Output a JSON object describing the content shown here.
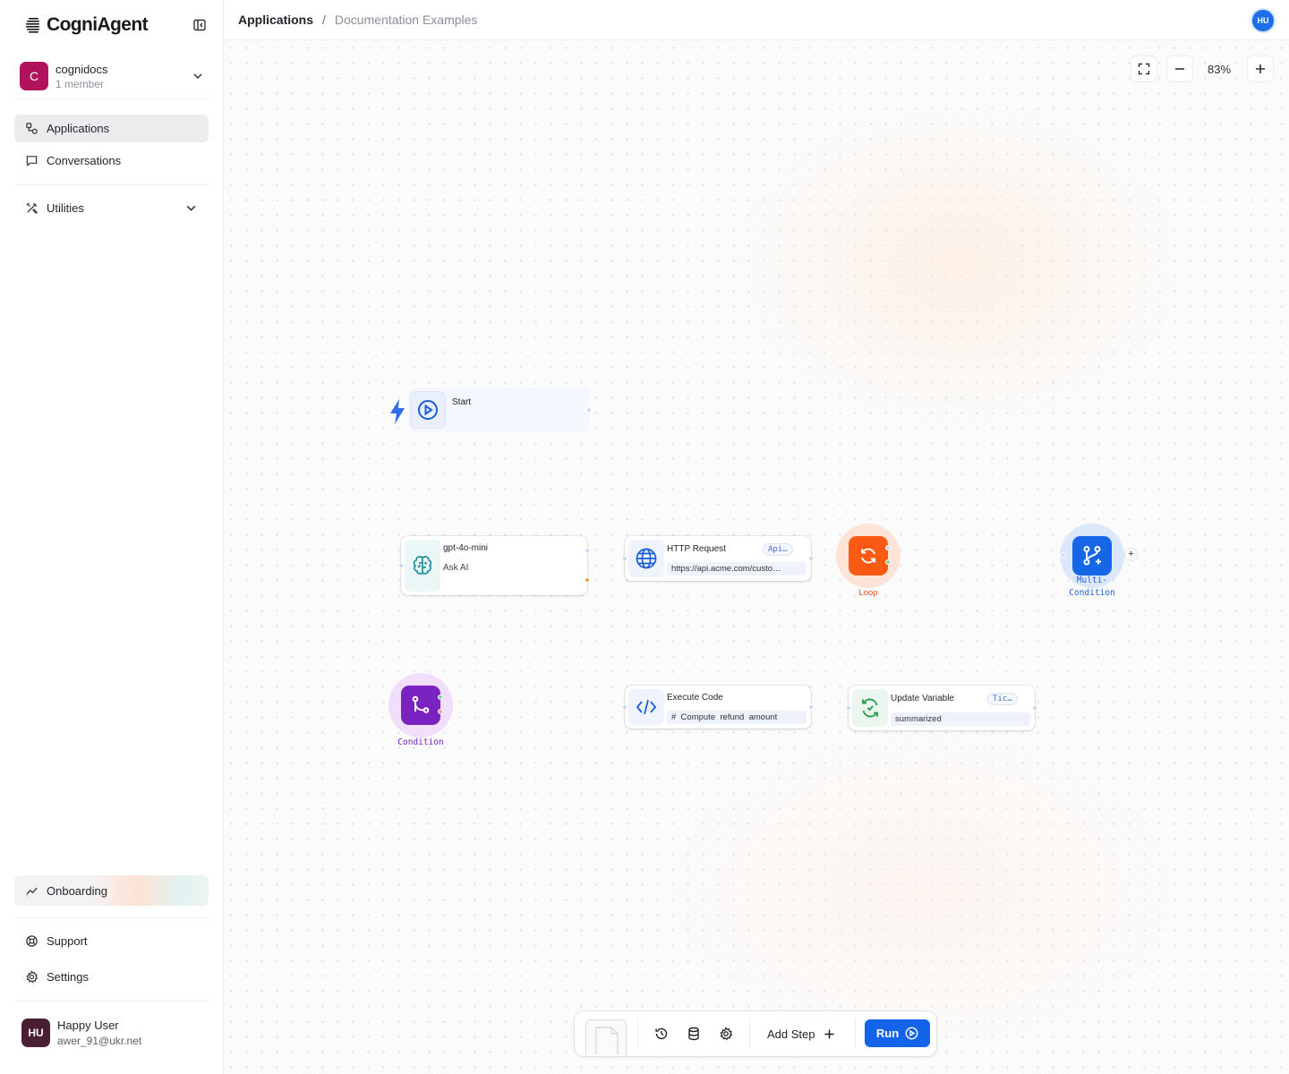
{
  "app": {
    "logo_text": "CogniAgent",
    "org_initial": "C",
    "org_name": "cognidocs",
    "org_members": "1 member"
  },
  "sidebar": {
    "nav": [
      {
        "label": "Applications",
        "icon": "applications-icon",
        "active": true
      },
      {
        "label": "Conversations",
        "icon": "chat-bubble-icon",
        "active": false
      }
    ],
    "utilities_label": "Utilities",
    "onboarding_label": "Onboarding",
    "bottom": [
      {
        "label": "Support",
        "icon": "lifebuoy-icon"
      },
      {
        "label": "Settings",
        "icon": "gear-icon"
      }
    ],
    "user": {
      "initials": "HU",
      "name": "Happy User",
      "email": "awer_91@ukr.net"
    }
  },
  "header": {
    "breadcrumb_root": "Applications",
    "breadcrumb_sep": "/",
    "breadcrumb_leaf": "Documentation Examples",
    "avatar_initials": "HU"
  },
  "canvas": {
    "zoom_level": "83%",
    "nodes": {
      "start": {
        "title": "Start"
      },
      "llm": {
        "title": "gpt-4o-mini",
        "subtitle": "Ask AI"
      },
      "http": {
        "title": "HTTP Request",
        "badge": "Api…",
        "field": "https://api.acme.com/custo…"
      },
      "loop": {
        "label": "Loop"
      },
      "multi": {
        "label_line1": "Multi-",
        "label_line2": "Condition",
        "add_symbol": "+"
      },
      "condition": {
        "label": "Condition"
      },
      "code": {
        "title": "Execute Code",
        "field": "#  Compute  refund  amount"
      },
      "update": {
        "title": "Update Variable",
        "badge": "Tic…",
        "field": "summarized"
      }
    }
  },
  "toolbar": {
    "add_step_label": "Add Step",
    "run_label": "Run"
  },
  "colors": {
    "accent": "#1463eb",
    "org_avatar": "#b0125b",
    "user_avatar": "#4a1f33",
    "loop": "#fb5a14",
    "condition": "#7a22c2",
    "multi_condition": "#1667e8"
  }
}
